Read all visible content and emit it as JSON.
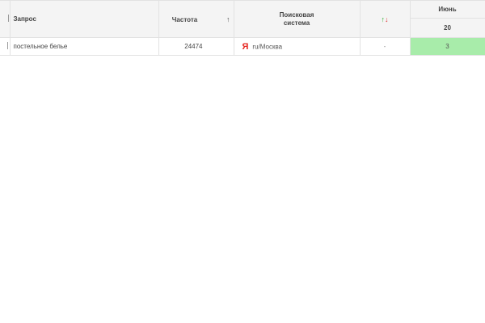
{
  "table": {
    "headers": {
      "query": "Запрос",
      "frequency": "Частота",
      "frequency_sort": "↑",
      "engine_line1": "Поисковая",
      "engine_line2": "система",
      "change_up": "↑",
      "change_down": "↓",
      "month": "Июнь",
      "day": "20"
    },
    "rows": [
      {
        "query": "постельное белье",
        "frequency": "24474",
        "engine_icon": "yandex-icon",
        "engine_icon_glyph": "Я",
        "region": "ru/Москва",
        "change": "-",
        "position": "3"
      }
    ]
  },
  "colors": {
    "header_bg": "#f4f4f4",
    "position_good": "#a8ecaa",
    "yandex_red": "#e52620",
    "arrow_up": "#2eaa2e",
    "arrow_down": "#dd3333"
  }
}
